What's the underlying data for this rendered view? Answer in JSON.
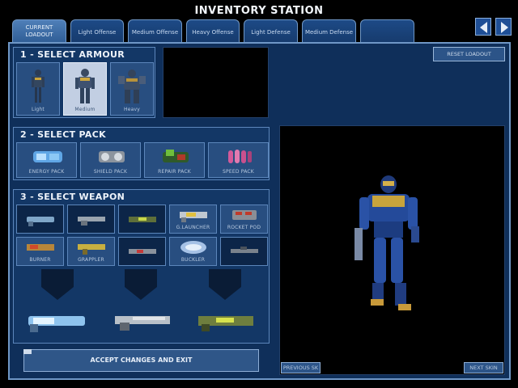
{
  "header": {
    "title": "INVENTORY STATION"
  },
  "tabs": [
    {
      "label_line1": "CURRENT",
      "label_line2": "LOADOUT",
      "active": true
    },
    {
      "label": "Light Offense",
      "active": false
    },
    {
      "label": "Medium Offense",
      "active": false
    },
    {
      "label": "Heavy Offense",
      "active": false
    },
    {
      "label": "Light Defense",
      "active": false
    },
    {
      "label": "Medium Defense",
      "active": false
    },
    {
      "label": "",
      "active": false
    }
  ],
  "armour": {
    "title": "1 - SELECT ARMOUR",
    "options": [
      {
        "label": "Light",
        "selected": false
      },
      {
        "label": "Medium",
        "selected": true
      },
      {
        "label": "Heavy",
        "selected": false
      }
    ]
  },
  "pack": {
    "title": "2 - SELECT PACK",
    "options": [
      {
        "label": "ENERGY PACK",
        "icon": "energy-pack-icon"
      },
      {
        "label": "SHIELD PACK",
        "icon": "shield-pack-icon"
      },
      {
        "label": "REPAIR PACK",
        "icon": "repair-pack-icon"
      },
      {
        "label": "SPEED PACK",
        "icon": "speed-pack-icon"
      }
    ]
  },
  "weapon": {
    "title": "3 - SELECT WEAPON",
    "options": [
      {
        "label": "",
        "icon": "spinfusor-icon"
      },
      {
        "label": "",
        "icon": "chaingun-icon"
      },
      {
        "label": "",
        "icon": "plasma-rifle-icon"
      },
      {
        "label": "G.LAUNCHER",
        "icon": "grenade-launcher-icon"
      },
      {
        "label": "ROCKET POD",
        "icon": "rocket-pod-icon"
      },
      {
        "label": "BURNER",
        "icon": "burner-icon"
      },
      {
        "label": "GRAPPLER",
        "icon": "grappler-icon"
      },
      {
        "label": "",
        "icon": "blaster-icon"
      },
      {
        "label": "BUCKLER",
        "icon": "buckler-icon"
      },
      {
        "label": "",
        "icon": "sniper-icon"
      }
    ],
    "loadout": [
      {
        "icon": "spinfusor-icon"
      },
      {
        "icon": "chaingun-icon"
      },
      {
        "icon": "plasma-rifle-icon"
      }
    ]
  },
  "buttons": {
    "reset": "RESET LOADOUT",
    "accept": "ACCEPT CHANGES AND EXIT",
    "previous_skin": "PREVIOUS SK",
    "next_skin": "NEXT SKIN"
  },
  "colors": {
    "frame": "#6f97c6",
    "panel": "#133766",
    "selected": "#c2cfe3",
    "accent": "#d4a52c"
  }
}
